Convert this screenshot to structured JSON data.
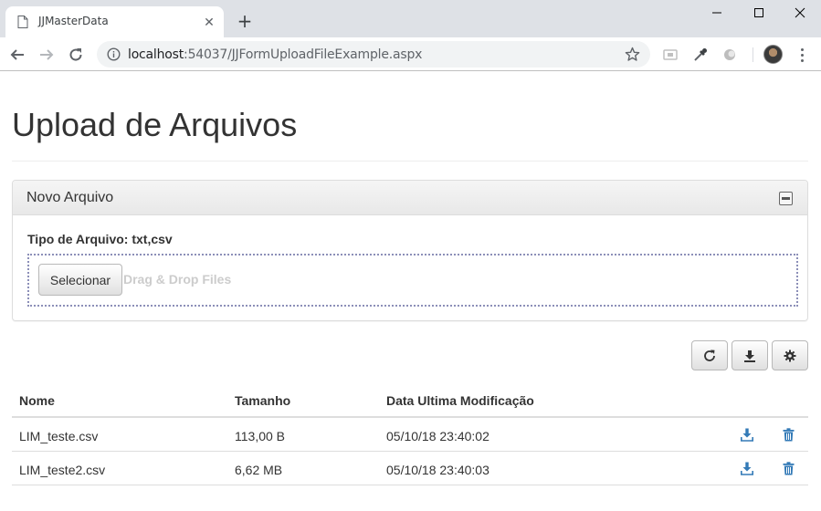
{
  "browser": {
    "tab_title": "JJMasterData",
    "tab_close": "✕",
    "new_tab": "+",
    "url_host": "localhost",
    "url_rest": ":54037/JJFormUploadFileExample.aspx",
    "icons": [
      "page-icon",
      "back-icon",
      "forward-icon",
      "reload-icon",
      "info-icon",
      "star-icon",
      "minimize-icon",
      "maximize-icon",
      "close-icon",
      "menu-icon"
    ]
  },
  "page": {
    "title": "Upload de Arquivos"
  },
  "panel": {
    "title": "Novo Arquivo",
    "file_type_label": "Tipo de Arquivo: txt,csv",
    "select_button": "Selecionar",
    "drop_text": "Drag & Drop Files"
  },
  "grid": {
    "columns": [
      "Nome",
      "Tamanho",
      "Data Ultima Modificação"
    ],
    "rows": [
      {
        "name": "LIM_teste.csv",
        "size": "113,00 B",
        "modified": "05/10/18 23:40:02"
      },
      {
        "name": "LIM_teste2.csv",
        "size": "6,62 MB",
        "modified": "05/10/18 23:40:03"
      }
    ]
  },
  "colors": {
    "accent_icon": "#337ab7",
    "dropzone_border": "#8c8fb8"
  }
}
